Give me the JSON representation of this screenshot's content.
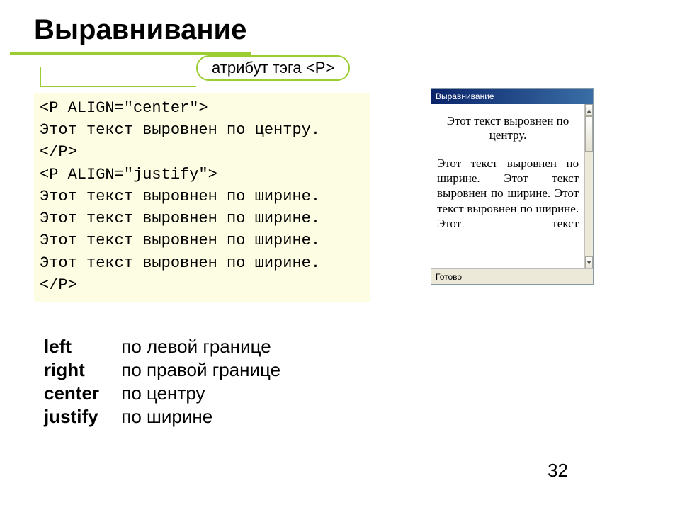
{
  "title": "Выравнивание",
  "callout": "атрибут тэга <P>",
  "code": "<P ALIGN=\"center\">\nЭтот текст выровнен по центру.\n</P>\n<P ALIGN=\"justify\">\nЭтот текст выровнен по ширине.\nЭтот текст выровнен по ширине.\nЭтот текст выровнен по ширине.\nЭтот текст выровнен по ширине.\n</P>",
  "defs": {
    "left": {
      "term": "left",
      "desc": "по левой границе"
    },
    "right": {
      "term": "right",
      "desc": "по правой границе"
    },
    "center": {
      "term": "center",
      "desc": "по центру"
    },
    "justify": {
      "term": "justify",
      "desc": "по ширине"
    }
  },
  "browser": {
    "title": "Выравнивание",
    "centered": "Этот текст выровнен по центру.",
    "justified": "Этот текст выровнен по ширине. Этот текст выровнен по ширине. Этот текст выровнен по ширине. Этот текст",
    "status": "Готово",
    "scroll_up": "▲",
    "scroll_down": "▼"
  },
  "page_number": "32"
}
